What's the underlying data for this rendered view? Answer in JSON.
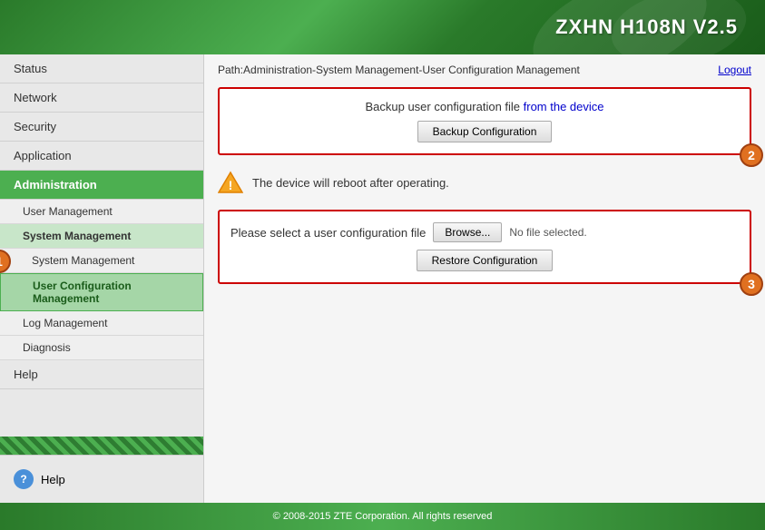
{
  "header": {
    "title": "ZXHN H108N V2.5"
  },
  "path": {
    "text": "Path:Administration-System Management-User Configuration Management",
    "logout": "Logout"
  },
  "sidebar": {
    "items": [
      {
        "label": "Status",
        "id": "status",
        "active": false
      },
      {
        "label": "Network",
        "id": "network",
        "active": false
      },
      {
        "label": "Security",
        "id": "security",
        "active": false
      },
      {
        "label": "Application",
        "id": "application",
        "active": false
      },
      {
        "label": "Administration",
        "id": "administration",
        "active": true
      }
    ],
    "sub_items": [
      {
        "label": "User Management",
        "id": "user-management",
        "active": false
      },
      {
        "label": "System Management",
        "id": "system-management-group",
        "active": true
      },
      {
        "label": "System Management",
        "id": "system-management",
        "active": false
      },
      {
        "label": "User Configuration Management",
        "id": "user-config-management",
        "active": true
      },
      {
        "label": "Log Management",
        "id": "log-management",
        "active": false
      },
      {
        "label": "Diagnosis",
        "id": "diagnosis",
        "active": false
      }
    ],
    "help_label": "Help"
  },
  "backup_section": {
    "description_start": "Backup user configuration file ",
    "description_highlight": "from the device",
    "button_label": "Backup Configuration"
  },
  "warning": {
    "text": "The device will reboot after operating."
  },
  "restore_section": {
    "label": "Please select a user configuration file",
    "browse_label": "Browse...",
    "no_file_text": "No file selected.",
    "button_label": "Restore Configuration"
  },
  "footer": {
    "text": "© 2008-2015 ZTE Corporation. All rights reserved"
  },
  "help_item": {
    "label": "Help"
  },
  "sidebar_last_item": {
    "label": "Help"
  }
}
